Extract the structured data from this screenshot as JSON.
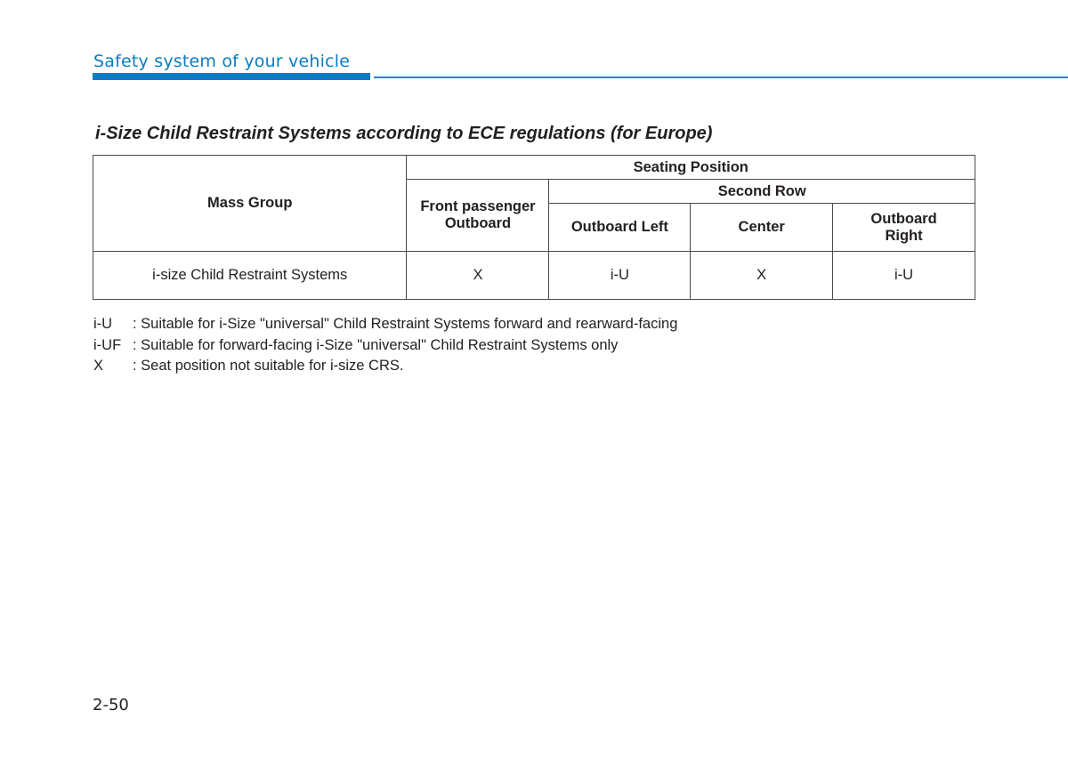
{
  "header": {
    "section_title": "Safety system of your vehicle",
    "accent_color": "#0a7cc1"
  },
  "content": {
    "title": "i-Size Child Restraint Systems according to ECE regulations (for Europe)",
    "table": {
      "headers": {
        "mass_group": "Mass Group",
        "seating_position": "Seating Position",
        "front_passenger": "Front passenger Outboard",
        "second_row": "Second Row",
        "outboard_left": "Outboard Left",
        "center": "Center",
        "outboard_right": "Outboard Right"
      },
      "rows": [
        {
          "mass_group": "i-size Child Restraint Systems",
          "front_passenger": "X",
          "outboard_left": "i-U",
          "center": "X",
          "outboard_right": "i-U"
        }
      ]
    },
    "legend": [
      {
        "key": "i-U",
        "text": ": Suitable for i-Size \"universal\" Child Restraint Systems forward and rearward-facing"
      },
      {
        "key": "i-UF",
        "text": ": Suitable for forward-facing i-Size \"universal\" Child Restraint Systems only"
      },
      {
        "key": "X",
        "text": ": Seat position not suitable for i-size CRS."
      }
    ]
  },
  "footer": {
    "page_number": "2-50"
  }
}
